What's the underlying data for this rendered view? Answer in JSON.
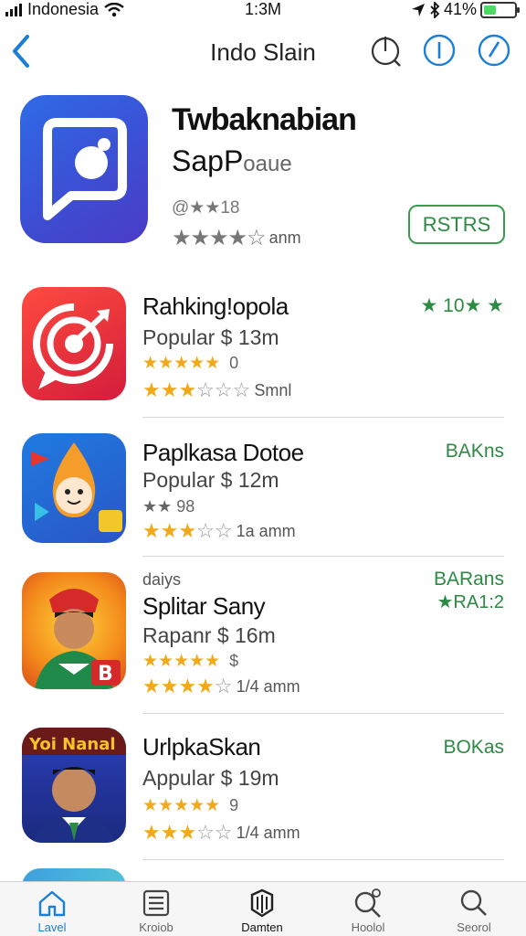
{
  "status_bar": {
    "carrier": "Indonesia",
    "time": "1:3M",
    "battery": "41%",
    "battery_level": 0.41
  },
  "nav": {
    "title": "Indo Slain"
  },
  "featured": {
    "title": "Twbaknabian",
    "subtitle_main": "SapP",
    "subtitle_muted": "oaue",
    "count": "@★★18",
    "stars": "★★★★☆",
    "size": "anm",
    "button": "RSTRS"
  },
  "apps": [
    {
      "name": "Rahking!opola",
      "category": "Popular $ 13m",
      "rating1_stars": "★★★★★",
      "rating1_num": "0",
      "rating2_stars": "★★★",
      "rating2_empty": "☆☆☆",
      "size": "Smnl",
      "right": "★ 10★ ★",
      "right2": ""
    },
    {
      "name": "Paplkasa Dotoe",
      "category": "Popular $ 12m",
      "small": "★★ 98",
      "rating2_stars": "★★★",
      "rating2_empty": "☆☆",
      "size": "1a amm",
      "right": "BAKns",
      "right2": ""
    },
    {
      "name": "Splitar Sany",
      "kicker": "daiys",
      "category": "Rapanr $ 16m",
      "rating1_stars": "★★★★★",
      "rating1_num": "$",
      "rating2_stars": "★★★★",
      "rating2_empty": "☆",
      "size": "1/4 amm",
      "right": "BARans",
      "right2": "★RA1:2"
    },
    {
      "name": "UrlpkaSkan",
      "category": "Appular $ 19m",
      "rating1_stars": "★★★★★",
      "rating1_num": "9",
      "rating2_stars": "★★★",
      "rating2_empty": "☆☆",
      "size": "1/4 amm",
      "right": "BOKas",
      "right2": ""
    }
  ],
  "tabs": [
    {
      "label": "Lavel",
      "icon": "home-icon"
    },
    {
      "label": "Kroiob",
      "icon": "list-icon"
    },
    {
      "label": "Damten",
      "icon": "games-icon"
    },
    {
      "label": "Hoolol",
      "icon": "search-plus-icon"
    },
    {
      "label": "Seorol",
      "icon": "search-icon"
    }
  ],
  "colors": {
    "accent": "#1a7fd8",
    "green": "#2c8a43",
    "star": "#f1a91a"
  }
}
